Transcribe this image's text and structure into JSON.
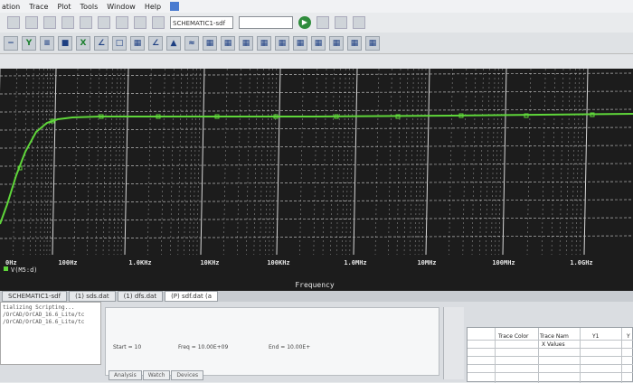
{
  "menu": {
    "items": [
      "ation",
      "Trace",
      "Plot",
      "Tools",
      "Window",
      "Help"
    ]
  },
  "toolbar": {
    "schematic_field": "SCHEMATIC1-sdf",
    "blank_field": ""
  },
  "tabs": [
    "SCHEMATIC1-sdf",
    "(1) sds.dat",
    "(1) dfs.dat",
    "(P) sdf.dat (a"
  ],
  "log": {
    "lines": [
      "tializing Scripting...",
      "/OrCAD/OrCAD_16.6_Lite/tc",
      "/OrCAD/OrCAD_16.6_Lite/tc"
    ]
  },
  "sim": {
    "start_label": "Start = 10",
    "freq_label": "Freq = 10.00E+09",
    "end_label": "End = 10.00E+"
  },
  "bottom_tabs": [
    "Analysis",
    "Watch",
    "Devices"
  ],
  "trace_table": {
    "col1": "Trace Color",
    "col2": "Trace Nam",
    "col3": "Y1",
    "col4": "Y",
    "row2": "X Values"
  },
  "plot": {
    "trace_color": "#5fd63a",
    "grid_color": "#d8d8d8",
    "background": "#1c1c1c",
    "x_tick_labels": [
      "0Hz",
      "100Hz",
      "1.0KHz",
      "10KHz",
      "100KHz",
      "1.0MHz",
      "10MHz",
      "100MHz",
      "1.0GHz"
    ],
    "x_axis_label": "Frequency",
    "legend_label": "V(M5:d)"
  }
}
